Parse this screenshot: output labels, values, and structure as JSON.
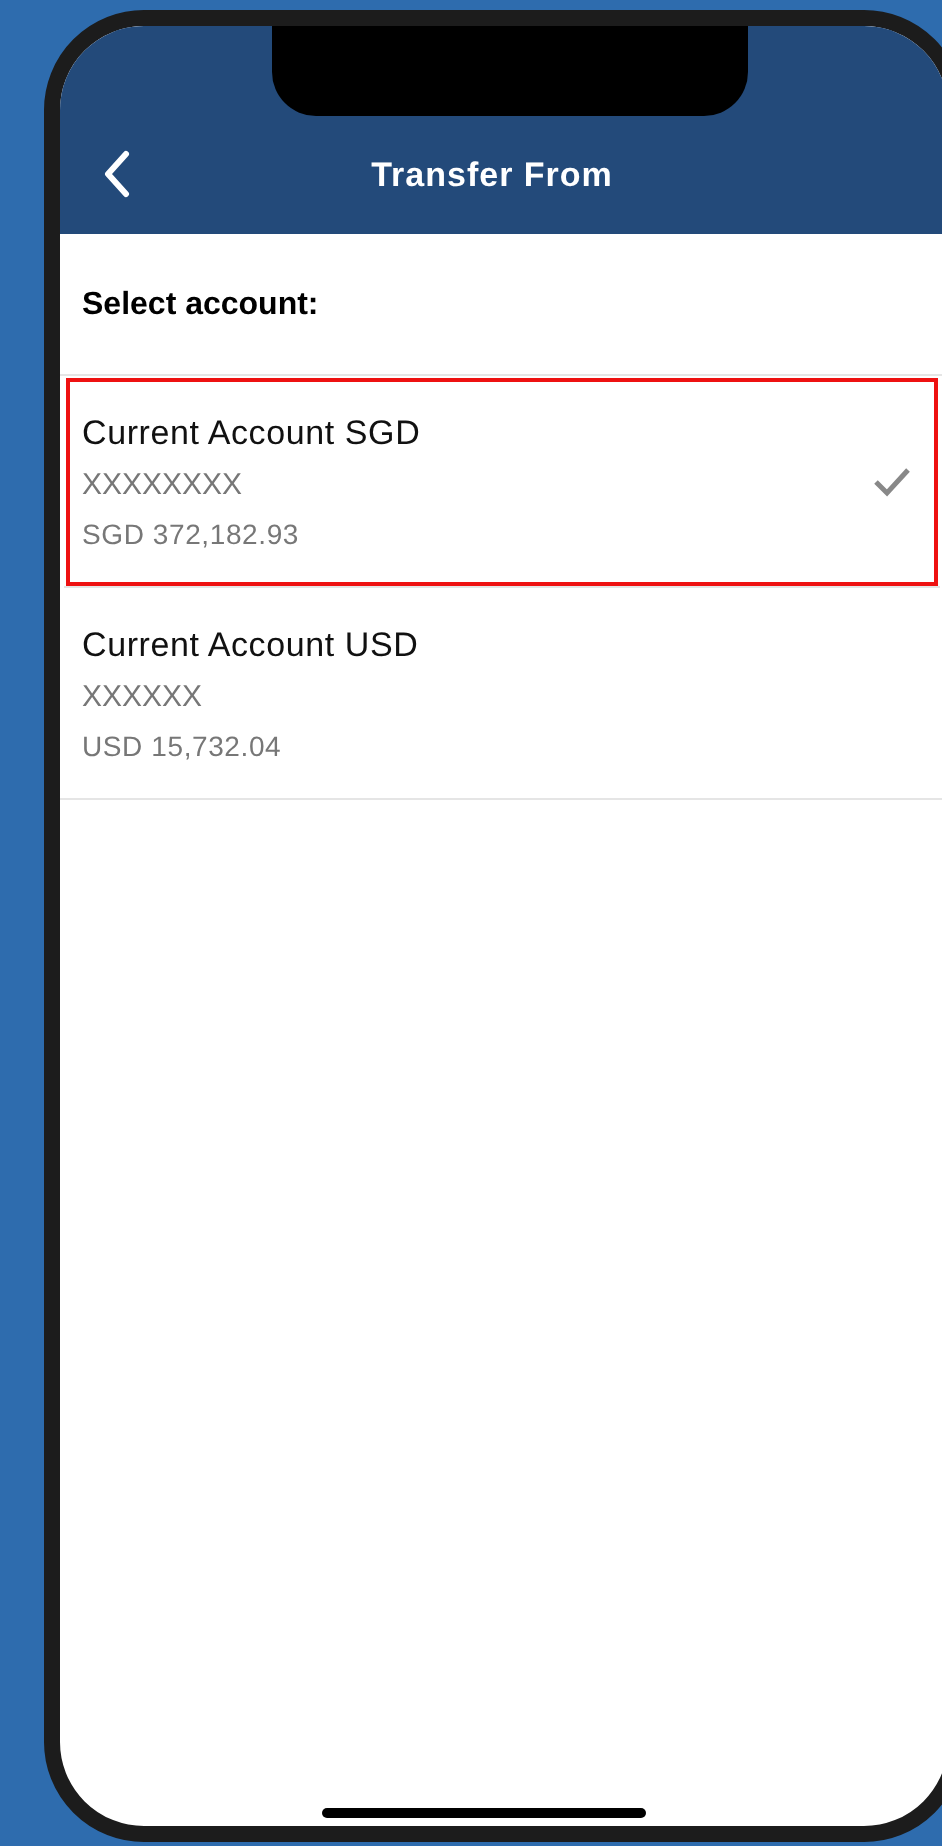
{
  "header": {
    "title": "Transfer From"
  },
  "prompt": "Select account:",
  "accounts": [
    {
      "name": "Current Account SGD",
      "number": "XXXXXXXX",
      "balance": "SGD 372,182.93",
      "selected": true,
      "highlighted": true
    },
    {
      "name": "Current Account USD",
      "number": "XXXXXX",
      "balance": "USD 15,732.04",
      "selected": false,
      "highlighted": false
    }
  ]
}
